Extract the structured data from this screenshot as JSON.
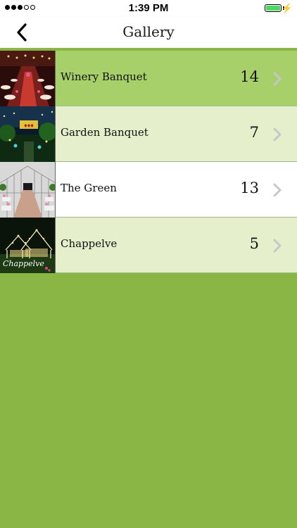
{
  "status": {
    "time": "1:39 PM",
    "battery_color": "#4cd964"
  },
  "nav": {
    "title": "Gallery",
    "back_icon": "chevron-left-icon"
  },
  "gallery": {
    "items": [
      {
        "label": "Winery Banquet",
        "count": "14",
        "thumb_icon": "banquet-hall-photo"
      },
      {
        "label": "Garden Banquet",
        "count": "7",
        "thumb_icon": "garden-night-photo"
      },
      {
        "label": "The Green",
        "count": "13",
        "thumb_icon": "greenhouse-aisle-photo"
      },
      {
        "label": "Chappelve",
        "count": "5",
        "thumb_icon": "chapel-lights-photo",
        "thumb_caption": "Chappelve"
      }
    ],
    "chevron_icon": "chevron-right-icon"
  },
  "colors": {
    "accent": "#8ab645",
    "row_dark": "#a8d06a",
    "row_light": "#e6efcb"
  }
}
